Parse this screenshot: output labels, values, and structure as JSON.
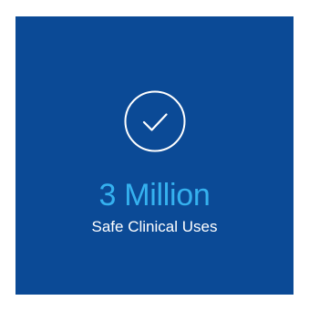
{
  "tile": {
    "background_color": "#0b4a96",
    "icon": "check-circle-icon",
    "headline": "3 Million",
    "headline_color": "#35b1ef",
    "subline": "Safe Clinical Uses",
    "subline_color": "#ffffff"
  }
}
